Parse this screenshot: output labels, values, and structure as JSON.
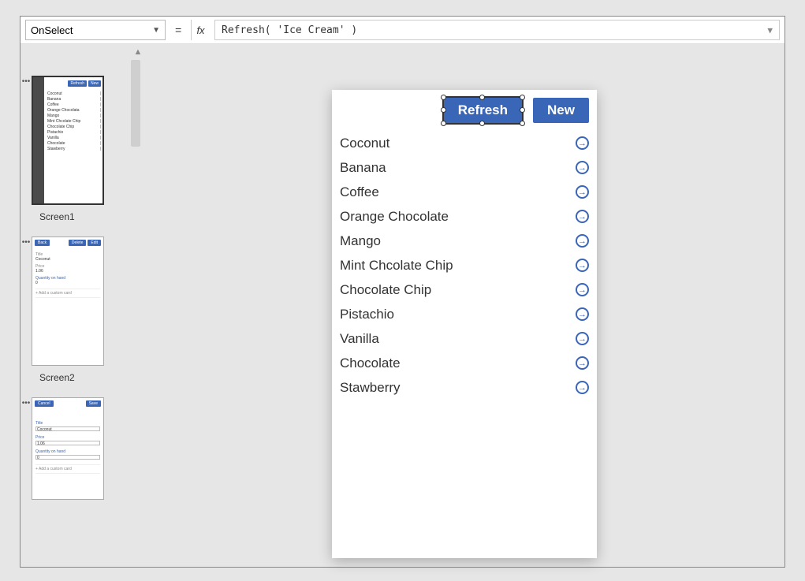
{
  "formula_bar": {
    "property": "OnSelect",
    "eq": "=",
    "fx": "fx",
    "formula": "Refresh( 'Ice Cream' )"
  },
  "screens": {
    "s1": {
      "label": "Screen1",
      "btn_refresh": "Refresh",
      "btn_new": "New"
    },
    "s2": {
      "label": "Screen2",
      "btn_back": "Back",
      "btn_delete": "Delete",
      "btn_edit": "Edit",
      "lbl_title": "Title",
      "val_title": "Coconut",
      "lbl_price": "Price",
      "val_price": "1.06",
      "lbl_qoh": "Quantity on hand",
      "val_qoh": "0",
      "add_card": "+  Add a custom card"
    },
    "s3": {
      "btn_cancel": "Cancel",
      "btn_save": "Save",
      "lbl_title": "Title",
      "val_title": "Coconut",
      "lbl_price": "Price",
      "val_price": "1.06",
      "lbl_qoh": "Quantity on hand",
      "val_qoh": "0",
      "add_card": "+  Add a custom card"
    }
  },
  "canvas": {
    "btn_refresh": "Refresh",
    "btn_new": "New",
    "items": [
      "Coconut",
      "Banana",
      "Coffee",
      "Orange Chocolate",
      "Mango",
      "Mint Chcolate Chip",
      "Chocolate Chip",
      "Pistachio",
      "Vanilla",
      "Chocolate",
      "Stawberry"
    ]
  },
  "thumb_items": [
    "Coconut",
    "Banana",
    "Coffee",
    "Orange Chocolata",
    "Mango",
    "Mint Chcolate Chip",
    "Chocolate Chip",
    "Pistachio",
    "Vanilla",
    "Chocolate",
    "Stawberry"
  ]
}
